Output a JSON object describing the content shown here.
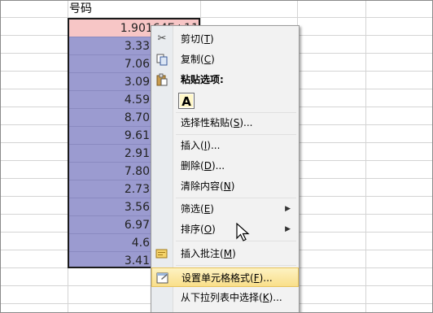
{
  "sheet": {
    "column_header": "号码",
    "first_value": "1.90164E+11",
    "values": [
      "3.33",
      "7.06",
      "3.09",
      "4.59",
      "8.70",
      "9.61",
      "2.91",
      "7.80",
      "2.73",
      "3.56",
      "6.97",
      "4.6",
      "3.41"
    ]
  },
  "context_menu": {
    "items": [
      {
        "label": "剪切",
        "key": "T",
        "icon": "scissors-icon"
      },
      {
        "label": "复制",
        "key": "C",
        "icon": "copy-icon"
      },
      {
        "label": "粘贴选项:",
        "key": "",
        "icon": "paste-icon"
      },
      {
        "label": "选择性粘贴",
        "key": "S",
        "suffix": "..."
      },
      {
        "label": "插入",
        "key": "I",
        "suffix": "..."
      },
      {
        "label": "删除",
        "key": "D",
        "suffix": "..."
      },
      {
        "label": "清除内容",
        "key": "N"
      },
      {
        "label": "筛选",
        "key": "E",
        "submenu": true
      },
      {
        "label": "排序",
        "key": "O",
        "submenu": true
      },
      {
        "label": "插入批注",
        "key": "M",
        "icon": "comment-icon"
      },
      {
        "label": "设置单元格格式",
        "key": "F",
        "suffix": "...",
        "icon": "format-cells-icon",
        "highlighted": true
      },
      {
        "label": "从下拉列表中选择",
        "key": "K",
        "suffix": "..."
      }
    ],
    "paste_option_label": "A"
  },
  "colors": {
    "selection": "#9b9bd0",
    "first_cell": "#f7c6c6",
    "menu_bg": "#f2f2f2",
    "highlight": "#f9df8a"
  }
}
